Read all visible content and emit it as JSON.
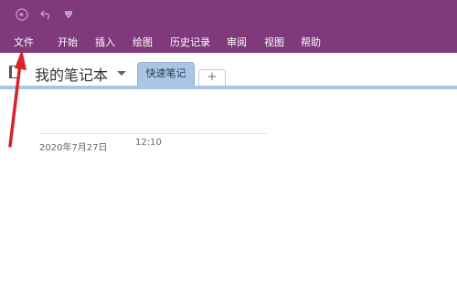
{
  "quick_access": {
    "back_icon": "back-arrow-icon",
    "undo_icon": "undo-icon",
    "customize_icon": "customize-dropdown-icon"
  },
  "ribbon_tabs": [
    "文件",
    "开始",
    "插入",
    "绘图",
    "历史记录",
    "审阅",
    "视图",
    "帮助"
  ],
  "notebook": {
    "name": "我的笔记本",
    "icon": "notebook-icon"
  },
  "sections": {
    "active_tab": "快速笔记",
    "add_tab": "+"
  },
  "page": {
    "date": "2020年7月27日",
    "time": "12:10"
  },
  "colors": {
    "ribbon": "#80397b",
    "section_tab": "#a9c6e6",
    "annotation_arrow": "#d9232b"
  }
}
